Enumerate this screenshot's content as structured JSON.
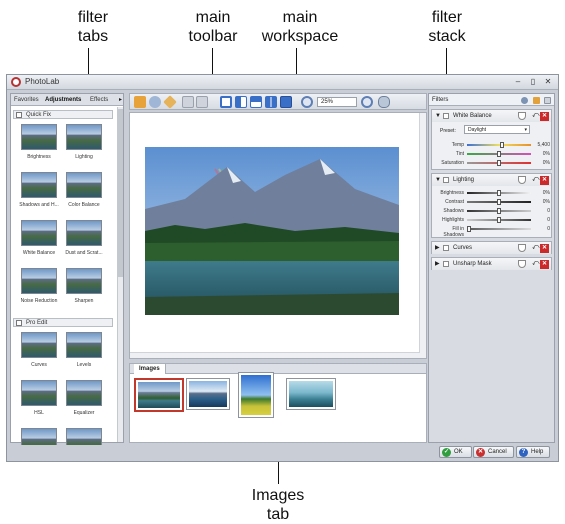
{
  "callouts": {
    "filter_tabs": [
      "filter",
      "tabs"
    ],
    "main_toolbar": [
      "main",
      "toolbar"
    ],
    "main_workspace": [
      "main",
      "workspace"
    ],
    "filter_stack": [
      "filter",
      "stack"
    ],
    "images_tab": [
      "Images",
      "tab"
    ]
  },
  "window": {
    "title": "PhotoLab",
    "controls": [
      "–",
      "▯",
      "✕"
    ]
  },
  "filter_tabs": {
    "tabs": [
      "Favorites",
      "Adjustments",
      "Effects"
    ],
    "active": "Adjustments",
    "more": "▸"
  },
  "filter_groups": [
    {
      "label": "Quick Fix",
      "items": [
        "Brightness",
        "Lighting",
        "Shadows and H...",
        "Color Balance",
        "White Balance",
        "Dust and Scrat...",
        "Noise Reduction",
        "Sharpen"
      ]
    },
    {
      "label": "Pro Edit",
      "items": [
        "Curves",
        "Levels",
        "HSL",
        "Equalizer",
        "",
        ""
      ]
    }
  ],
  "toolbar": {
    "zoom_value": "25%",
    "icons": [
      "hand-tool-icon",
      "eye-icon",
      "tag-icon",
      "undo-icon",
      "redo-icon",
      "single-view-icon",
      "split-view-icon",
      "compare-view-icon",
      "side-by-side-icon",
      "before-after-icon",
      "zoom-out-icon",
      "zoom-in-icon",
      "binoculars-icon"
    ]
  },
  "images_panel": {
    "tab_label": "Images"
  },
  "filter_stack": {
    "header": "Filters",
    "filters": [
      {
        "name": "White Balance",
        "expanded": true,
        "preset_label": "Preset:",
        "preset_value": "Daylight",
        "sliders": [
          {
            "label": "Temp",
            "value": "5,400",
            "level": 0.55,
            "track": "linear-gradient(90deg,#3b6fd8,#f0e060,#e8902a)"
          },
          {
            "label": "Tint",
            "value": "0%",
            "level": 0.5,
            "track": "linear-gradient(90deg,#3aa845,#d84fb8)"
          },
          {
            "label": "Saturation",
            "value": "0%",
            "level": 0.5,
            "track": "linear-gradient(90deg,#999999,#e03030)"
          }
        ]
      },
      {
        "name": "Lighting",
        "expanded": true,
        "sliders": [
          {
            "label": "Brightness",
            "value": "0%",
            "level": 0.5,
            "track": "linear-gradient(90deg,#222222,#f4f4f4)"
          },
          {
            "label": "Contrast",
            "value": "0%",
            "level": 0.5,
            "track": "linear-gradient(90deg,#777777,#222222)"
          },
          {
            "label": "Shadows",
            "value": "0",
            "level": 0.5,
            "track": "linear-gradient(90deg,#333333,#cccccc)"
          },
          {
            "label": "Highlights",
            "value": "0",
            "level": 0.5,
            "track": "linear-gradient(90deg,#cccccc,#333333)"
          },
          {
            "label": "Fill in Shadows",
            "value": "0",
            "level": 0.0,
            "track": "linear-gradient(90deg,#555555,#dddddd)"
          }
        ]
      },
      {
        "name": "Curves",
        "expanded": false,
        "sliders": []
      },
      {
        "name": "Unsharp Mask",
        "expanded": false,
        "sliders": []
      }
    ]
  },
  "bottom_buttons": [
    {
      "label": "OK",
      "icon": "ok-icon",
      "color": "#2f9e3f",
      "glyph": "✓"
    },
    {
      "label": "Cancel",
      "icon": "cancel-icon",
      "color": "#c93030",
      "glyph": "✕"
    },
    {
      "label": "Help",
      "icon": "help-icon",
      "color": "#2f63c2",
      "glyph": "?"
    }
  ]
}
